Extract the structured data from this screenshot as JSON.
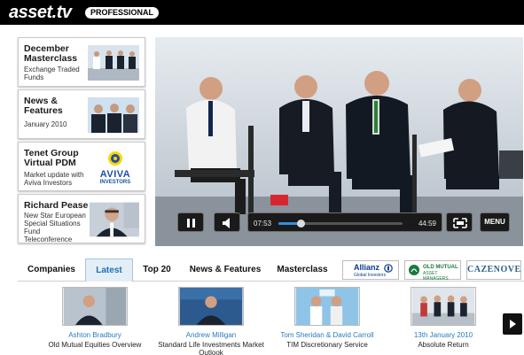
{
  "header": {
    "logo": "asset.tv",
    "badge": "PROFESSIONAL"
  },
  "cards": [
    {
      "title": "December Masterclass",
      "subtitle": "Exchange Traded Funds"
    },
    {
      "title": "News & Features",
      "subtitle": "January 2010"
    },
    {
      "title": "Tenet Group Virtual PDM",
      "subtitle": "Market update with Aviva Investors",
      "logo": "AVIVA INVESTORS"
    },
    {
      "title": "Richard Pease",
      "subtitle": "New Star European Special Situations Fund Teleconference"
    }
  ],
  "player": {
    "elapsed": "07:53",
    "duration": "44:59",
    "progress": 0.175,
    "menu_label": "MENU",
    "icons": [
      "pause-icon",
      "volume-icon",
      "fullscreen-icon"
    ]
  },
  "tabs": [
    "Companies",
    "Latest",
    "Top 20",
    "News & Features",
    "Masterclass"
  ],
  "active_tab": "Latest",
  "sponsors": {
    "allianz": "Allianz",
    "allianz_sub": "Global Investors",
    "old_mutual": "OLD MUTUAL",
    "old_mutual_sub": "ASSET MANAGERS",
    "cazenove": "CAZENOVE"
  },
  "videos": [
    {
      "name": "Ashton Bradbury",
      "desc": "Old Mutual Equities Overview"
    },
    {
      "name": "Andrew Milligan",
      "desc": "Standard Life Investments Market Outlook"
    },
    {
      "name": "Tom Sheridan & David Carroll",
      "desc": "TIM Discretionary Service"
    },
    {
      "name": "13th January 2010",
      "desc": "Absolute Return"
    }
  ],
  "colors": {
    "accent_blue": "#2a7bbf",
    "logo_orange": "#f08a1c",
    "header_black": "#000000"
  }
}
